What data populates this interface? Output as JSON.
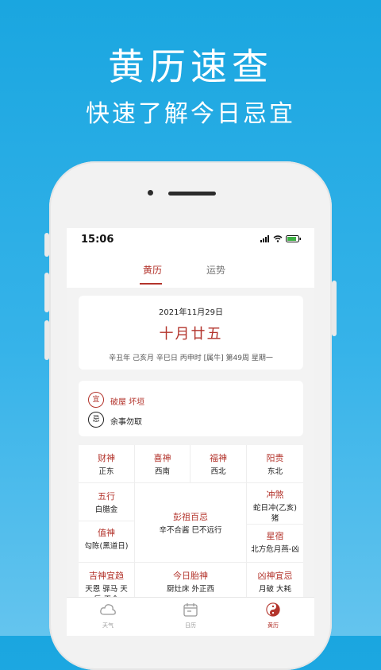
{
  "promo": {
    "title": "黄历速查",
    "subtitle": "快速了解今日忌宜"
  },
  "status_bar": {
    "time": "15:06"
  },
  "tabs": [
    {
      "label": "黄历"
    },
    {
      "label": "运势"
    }
  ],
  "date_card": {
    "solar_date": "2021年11月29日",
    "lunar_date": "十月廿五",
    "ganzhi": "辛丑年 己亥月 辛巳日 丙申时 [属牛] 第49周 星期一"
  },
  "yi_ji": {
    "yi_badge": "宜",
    "yi_text": "破屋 坏垣",
    "ji_badge": "忌",
    "ji_text": "余事勿取"
  },
  "grid": {
    "caishen": {
      "title": "财神",
      "value": "正东"
    },
    "xishen": {
      "title": "喜神",
      "value": "西南"
    },
    "fushen": {
      "title": "福神",
      "value": "西北"
    },
    "yanggui": {
      "title": "阳贵",
      "value": "东北"
    },
    "wuxing": {
      "title": "五行",
      "value": "白腊金"
    },
    "chongsha": {
      "title": "冲煞",
      "value": "蛇日冲(乙亥)猪"
    },
    "pengzu": {
      "title": "彭祖百忌",
      "value": "辛不合酱 巳不远行"
    },
    "zhishen": {
      "title": "值神",
      "value": "勾陈(黑道日)"
    },
    "xingxiu": {
      "title": "星宿",
      "value": "北方危月燕-凶"
    },
    "jishen": {
      "title": "吉神宜趋",
      "value": "天恩 驿马 天后 天仓"
    },
    "taishen": {
      "title": "今日胎神",
      "value": "厨灶床 外正西"
    },
    "xiongshen": {
      "title": "凶神宜忌",
      "value": "月破 大耗"
    }
  },
  "bottom_nav": [
    {
      "label": "天气"
    },
    {
      "label": "日历"
    },
    {
      "label": "黄历"
    }
  ],
  "colors": {
    "accent": "#b3342c",
    "background": "#1aa6e0"
  }
}
